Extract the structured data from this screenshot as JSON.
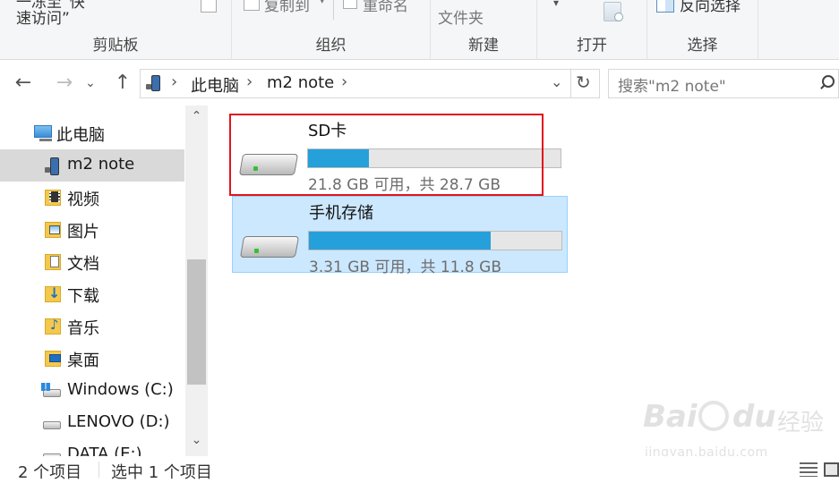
{
  "ribbon": {
    "top_partial_left": "一冻至“快",
    "quick_access_label": "速访问”",
    "copy_to_label": "复制到",
    "rename_label": "重命名",
    "new_folder_label": "文件夹",
    "invert_select_label": "反向选择",
    "groups": [
      "剪贴板",
      "组织",
      "新建",
      "打开",
      "选择"
    ]
  },
  "address": {
    "crumbs": [
      "此电脑",
      "m2 note"
    ],
    "search_placeholder": "搜索\"m2 note\""
  },
  "nav": {
    "items": [
      {
        "label": "此电脑",
        "icon": "computer-icon"
      },
      {
        "label": "m2 note",
        "icon": "phone-icon",
        "selected": true
      },
      {
        "label": "视频",
        "icon": "video-folder-icon"
      },
      {
        "label": "图片",
        "icon": "pictures-folder-icon"
      },
      {
        "label": "文档",
        "icon": "documents-folder-icon"
      },
      {
        "label": "下载",
        "icon": "downloads-folder-icon"
      },
      {
        "label": "音乐",
        "icon": "music-folder-icon"
      },
      {
        "label": "桌面",
        "icon": "desktop-folder-icon"
      },
      {
        "label": "Windows (C:)",
        "icon": "windows-drive-icon"
      },
      {
        "label": "LENOVO (D:)",
        "icon": "drive-icon"
      },
      {
        "label": "DATA (E:)",
        "icon": "drive-icon"
      }
    ]
  },
  "drives": [
    {
      "name": "SD卡",
      "info": "21.8 GB 可用，共 28.7 GB",
      "used_fraction": 0.24,
      "highlighted": false,
      "marked": true
    },
    {
      "name": "手机存储",
      "info": "3.31 GB 可用，共 11.8 GB",
      "used_fraction": 0.72,
      "highlighted": true,
      "marked": false
    }
  ],
  "status": {
    "item_count": "2 个项目",
    "selected_count": "选中 1 个项目"
  },
  "watermark": {
    "brand": "Bai",
    "brand2": "du",
    "cn": "经验",
    "url": "jingyan.baidu.com"
  },
  "colors": {
    "accent": "#26a0da",
    "selection": "#cce8ff",
    "nav_selected": "#d9d9d9",
    "annotation_red": "#e0141e"
  }
}
